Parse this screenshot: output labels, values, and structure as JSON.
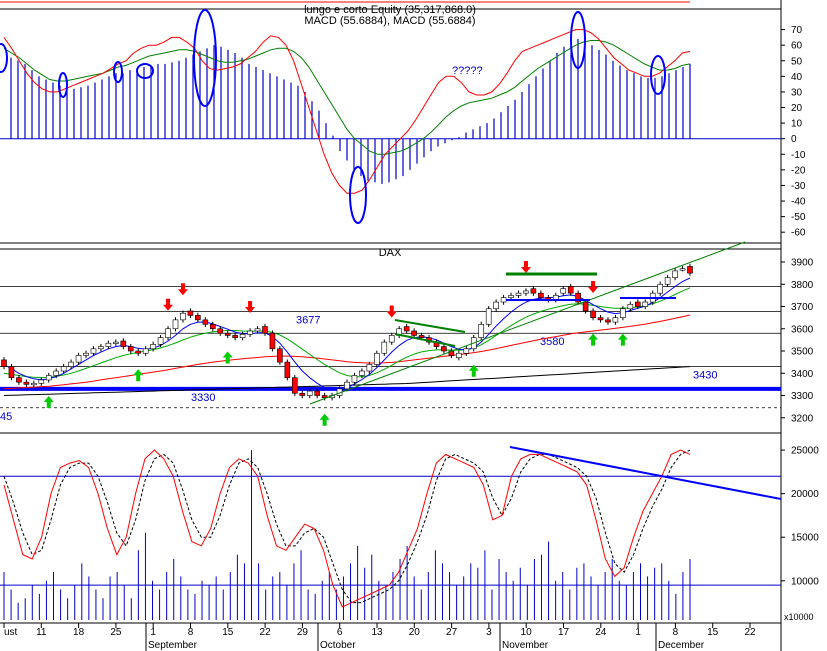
{
  "colors": {
    "background": "#ffffff",
    "frame": "#000000",
    "macd_hist": "#0000cc",
    "macd_line": "#ff0000",
    "signal_line": "#008000",
    "ellipse": "#0000ff",
    "annotation_text": "#0000cc",
    "bull_candle": "#ffffff",
    "bear_candle": "#ff0000",
    "arrow_down": "#ff0000",
    "arrow_up": "#00cc00",
    "support_line": "#0000ff",
    "ma_short": "#0000ff",
    "ma_mid": "#00aa00",
    "ma_long_red": "#ff0000",
    "ma_long_black": "#000000",
    "stoch_k": "#ff0000",
    "stoch_d": "#000000",
    "volume": "#0000cc",
    "green_line": "#008000"
  },
  "chart_data": [
    {
      "type": "line",
      "panel": "macd",
      "title_lines": [
        "lungo e corto Equity (35,317,868.0)",
        "MACD (55.6884), MACD (55.6884)"
      ],
      "annotation": "?????",
      "y_ticks": [
        70,
        60,
        50,
        40,
        30,
        20,
        10,
        0,
        -10,
        -20,
        -30,
        -40,
        -50,
        -60
      ],
      "y_tick_labels": [
        "70",
        "60",
        "50",
        "40",
        "30",
        "20",
        "10",
        "0",
        "-10",
        "-20",
        "-30",
        "-40",
        "-50",
        "-60"
      ],
      "ylim": [
        -65,
        80
      ],
      "histogram": [
        0,
        52,
        50,
        48,
        44,
        40,
        38,
        36,
        34,
        33,
        32,
        33,
        34,
        36,
        38,
        40,
        42,
        42,
        44,
        45,
        46,
        47,
        48,
        48,
        49,
        50,
        52,
        54,
        56,
        58,
        60,
        59,
        57,
        55,
        52,
        48,
        46,
        44,
        42,
        40,
        38,
        36,
        34,
        30,
        24,
        18,
        10,
        2,
        -8,
        -14,
        -20,
        -24,
        -27,
        -28,
        -29,
        -28,
        -26,
        -24,
        -20,
        -16,
        -12,
        -8,
        -5,
        -3,
        -1,
        1,
        4,
        6,
        8,
        10,
        13,
        17,
        21,
        25,
        30,
        35,
        40,
        45,
        50,
        55,
        59,
        62,
        64,
        63,
        60,
        57,
        54,
        50,
        47,
        44,
        42,
        40,
        39,
        39,
        40,
        42,
        44,
        46,
        48
      ],
      "macd": [
        65,
        58,
        50,
        42,
        36,
        32,
        30,
        30,
        32,
        34,
        36,
        38,
        40,
        42,
        45,
        48,
        50,
        55,
        58,
        60,
        60,
        62,
        65,
        65,
        62,
        58,
        50,
        45,
        44,
        45,
        46,
        48,
        52,
        56,
        62,
        66,
        65,
        60,
        50,
        35,
        20,
        5,
        -10,
        -22,
        -30,
        -35,
        -35,
        -33,
        -26,
        -18,
        -10,
        -5,
        0,
        5,
        12,
        20,
        28,
        36,
        40,
        40,
        36,
        30,
        28,
        28,
        30,
        35,
        42,
        50,
        56,
        58,
        60,
        62,
        64,
        66,
        68,
        70,
        70,
        68,
        64,
        58,
        52,
        48,
        44,
        42,
        40,
        40,
        42,
        46,
        50,
        55,
        56
      ],
      "signal": [
        58,
        55,
        52,
        48,
        44,
        41,
        38,
        37,
        37,
        38,
        39,
        40,
        41,
        42,
        44,
        46,
        47,
        49,
        51,
        53,
        54,
        55,
        56,
        57,
        57,
        56,
        54,
        52,
        50,
        49,
        49,
        50,
        51,
        53,
        55,
        57,
        58,
        58,
        56,
        52,
        46,
        38,
        30,
        22,
        14,
        6,
        0,
        -4,
        -8,
        -10,
        -10,
        -9,
        -8,
        -6,
        -3,
        0,
        4,
        9,
        14,
        18,
        21,
        23,
        24,
        25,
        26,
        28,
        30,
        33,
        37,
        41,
        45,
        48,
        51,
        54,
        57,
        60,
        62,
        63,
        63,
        62,
        60,
        57,
        54,
        51,
        48,
        46,
        44,
        44,
        45,
        47,
        48
      ]
    },
    {
      "type": "candlestick",
      "panel": "price",
      "title": "DAX",
      "y_ticks": [
        3900,
        3800,
        3700,
        3600,
        3500,
        3400,
        3300,
        3200
      ],
      "y_tick_labels": [
        "3900",
        "3800",
        "3700",
        "3600",
        "3500",
        "3400",
        "3300",
        "3200"
      ],
      "ylim": [
        3145,
        3945
      ],
      "level_labels": [
        {
          "value": 3677,
          "text": "3677"
        },
        {
          "value": 3330,
          "text": "3330"
        },
        {
          "value": 3580,
          "text": "3580"
        },
        {
          "value": 3430,
          "text": "3430"
        },
        {
          "value": 3245,
          "text": "45"
        }
      ],
      "horizontal_levels": [
        3790,
        3677,
        3580,
        3430,
        3245
      ],
      "support_level": 3330,
      "closes": [
        3430,
        3380,
        3360,
        3350,
        3355,
        3370,
        3390,
        3410,
        3430,
        3450,
        3480,
        3490,
        3510,
        3520,
        3535,
        3540,
        3520,
        3500,
        3490,
        3510,
        3530,
        3560,
        3600,
        3640,
        3670,
        3660,
        3640,
        3620,
        3600,
        3580,
        3570,
        3560,
        3575,
        3590,
        3600,
        3580,
        3510,
        3450,
        3380,
        3310,
        3300,
        3320,
        3300,
        3290,
        3300,
        3330,
        3360,
        3390,
        3410,
        3440,
        3490,
        3540,
        3570,
        3600,
        3590,
        3570,
        3560,
        3540,
        3520,
        3500,
        3480,
        3490,
        3510,
        3560,
        3620,
        3690,
        3720,
        3740,
        3750,
        3760,
        3770,
        3760,
        3740,
        3730,
        3750,
        3780,
        3760,
        3720,
        3680,
        3650,
        3640,
        3630,
        3650,
        3690,
        3710,
        3700,
        3720,
        3760,
        3800,
        3830,
        3860,
        3870,
        3850
      ],
      "opens": [
        3460,
        3430,
        3380,
        3360,
        3350,
        3355,
        3370,
        3390,
        3410,
        3430,
        3450,
        3480,
        3490,
        3510,
        3520,
        3535,
        3545,
        3520,
        3500,
        3490,
        3510,
        3530,
        3560,
        3600,
        3640,
        3680,
        3660,
        3640,
        3620,
        3600,
        3580,
        3570,
        3560,
        3575,
        3590,
        3610,
        3580,
        3510,
        3450,
        3380,
        3310,
        3300,
        3320,
        3300,
        3290,
        3300,
        3330,
        3360,
        3390,
        3410,
        3440,
        3490,
        3540,
        3570,
        3610,
        3590,
        3570,
        3560,
        3540,
        3520,
        3500,
        3470,
        3490,
        3510,
        3560,
        3620,
        3690,
        3720,
        3740,
        3750,
        3760,
        3780,
        3760,
        3740,
        3730,
        3760,
        3790,
        3760,
        3720,
        3680,
        3650,
        3640,
        3630,
        3650,
        3690,
        3720,
        3700,
        3720,
        3760,
        3800,
        3830,
        3870,
        3880
      ],
      "ma_short": [
        3440,
        3420,
        3400,
        3385,
        3375,
        3370,
        3375,
        3385,
        3400,
        3420,
        3440,
        3460,
        3480,
        3495,
        3510,
        3520,
        3525,
        3520,
        3512,
        3508,
        3512,
        3525,
        3545,
        3570,
        3600,
        3620,
        3630,
        3630,
        3622,
        3610,
        3598,
        3585,
        3578,
        3578,
        3582,
        3582,
        3565,
        3535,
        3495,
        3450,
        3410,
        3380,
        3355,
        3335,
        3325,
        3325,
        3335,
        3352,
        3372,
        3395,
        3425,
        3460,
        3495,
        3525,
        3548,
        3560,
        3565,
        3560,
        3550,
        3535,
        3520,
        3508,
        3505,
        3515,
        3540,
        3575,
        3612,
        3645,
        3675,
        3700,
        3720,
        3732,
        3738,
        3740,
        3742,
        3748,
        3752,
        3745,
        3728,
        3708,
        3690,
        3675,
        3668,
        3672,
        3682,
        3692,
        3702,
        3718,
        3740,
        3765,
        3790,
        3812,
        3828
      ],
      "ma_mid": [
        3400,
        3395,
        3390,
        3385,
        3382,
        3380,
        3382,
        3386,
        3392,
        3400,
        3410,
        3422,
        3434,
        3446,
        3458,
        3470,
        3480,
        3488,
        3494,
        3500,
        3506,
        3514,
        3524,
        3536,
        3550,
        3562,
        3572,
        3580,
        3586,
        3590,
        3592,
        3592,
        3590,
        3589,
        3590,
        3590,
        3584,
        3572,
        3555,
        3532,
        3508,
        3485,
        3462,
        3440,
        3420,
        3402,
        3390,
        3384,
        3384,
        3390,
        3402,
        3418,
        3436,
        3455,
        3472,
        3486,
        3496,
        3502,
        3505,
        3505,
        3504,
        3504,
        3506,
        3514,
        3528,
        3548,
        3570,
        3592,
        3614,
        3634,
        3652,
        3666,
        3678,
        3688,
        3696,
        3704,
        3710,
        3712,
        3710,
        3705,
        3700,
        3695,
        3692,
        3692,
        3694,
        3698,
        3703,
        3712,
        3724,
        3738,
        3754,
        3770,
        3784
      ],
      "ma_long_red": [
        3330,
        3332,
        3334,
        3336,
        3338,
        3340,
        3342,
        3345,
        3348,
        3352,
        3356,
        3360,
        3365,
        3370,
        3375,
        3380,
        3385,
        3390,
        3395,
        3400,
        3405,
        3410,
        3416,
        3422,
        3428,
        3434,
        3440,
        3445,
        3450,
        3454,
        3458,
        3462,
        3465,
        3468,
        3471,
        3474,
        3476,
        3477,
        3477,
        3476,
        3474,
        3471,
        3468,
        3464,
        3460,
        3456,
        3452,
        3449,
        3447,
        3446,
        3446,
        3447,
        3449,
        3452,
        3456,
        3460,
        3464,
        3468,
        3472,
        3476,
        3480,
        3484,
        3488,
        3493,
        3498,
        3504,
        3511,
        3518,
        3525,
        3532,
        3539,
        3546,
        3553,
        3559,
        3565,
        3571,
        3577,
        3582,
        3586,
        3590,
        3594,
        3598,
        3602,
        3606,
        3611,
        3616,
        3621,
        3627,
        3633,
        3640,
        3647,
        3654,
        3662
      ],
      "ma_long_black": [
        3300,
        3301,
        3302,
        3303,
        3304,
        3305,
        3306,
        3307,
        3308,
        3309,
        3310,
        3311,
        3312,
        3313,
        3314,
        3315,
        3316,
        3317,
        3318,
        3319,
        3320,
        3321,
        3322,
        3323,
        3324,
        3325,
        3326,
        3327,
        3328,
        3329,
        3330,
        3331,
        3332,
        3333,
        3334,
        3335,
        3336,
        3337,
        3338,
        3339,
        3340,
        3341,
        3342,
        3343,
        3344,
        3345,
        3346,
        3347,
        3348,
        3349,
        3350,
        3351,
        3352,
        3353,
        3354,
        3356,
        3358,
        3360,
        3362,
        3364,
        3366,
        3368,
        3370,
        3372,
        3374,
        3376,
        3378,
        3380,
        3382,
        3384,
        3386,
        3388,
        3390,
        3392,
        3394,
        3396,
        3398,
        3400,
        3402,
        3404,
        3406,
        3408,
        3410,
        3412,
        3414,
        3416,
        3418,
        3420,
        3422,
        3424,
        3426,
        3428,
        3430
      ],
      "arrows_down": [
        22,
        24,
        33,
        52,
        70,
        79,
        93
      ],
      "arrows_up": [
        6,
        18,
        30,
        43,
        63,
        79,
        83
      ]
    },
    {
      "type": "line",
      "panel": "stochastic_volume",
      "y_ticks": [
        25000,
        20000,
        15000,
        10000
      ],
      "y_tick_labels": [
        "25000",
        "20000",
        "15000",
        "10000"
      ],
      "ylim": [
        5500,
        26500
      ],
      "unit_label": "x10000",
      "reference_levels": [
        22000,
        9500
      ],
      "stoch_k": [
        21000,
        17000,
        13000,
        12500,
        15000,
        20000,
        23000,
        23500,
        23800,
        23000,
        20000,
        16000,
        13000,
        15000,
        20000,
        24000,
        25000,
        24000,
        22000,
        18000,
        14500,
        14000,
        16000,
        20000,
        23000,
        24000,
        23500,
        22000,
        17500,
        14000,
        13500,
        15000,
        16500,
        16000,
        13500,
        9500,
        7000,
        7500,
        8000,
        8500,
        9000,
        9500,
        11000,
        13500,
        16000,
        20000,
        23500,
        24500,
        24000,
        23500,
        23000,
        21000,
        17000,
        17500,
        22000,
        24000,
        24500,
        24500,
        24000,
        23500,
        23000,
        22500,
        21000,
        17000,
        12500,
        10500,
        11500,
        15000,
        18000,
        20000,
        22000,
        24500,
        25000,
        24500
      ],
      "stoch_d": [
        22000,
        19000,
        15500,
        13000,
        13500,
        17000,
        21000,
        23000,
        23500,
        23500,
        22000,
        19000,
        15500,
        14000,
        17000,
        21500,
        24000,
        24500,
        23500,
        20500,
        17000,
        15000,
        15000,
        17500,
        21000,
        23500,
        24000,
        23000,
        20000,
        16500,
        14000,
        14000,
        15500,
        16000,
        15000,
        12000,
        9000,
        7500,
        7500,
        8000,
        8500,
        9000,
        10000,
        12000,
        14500,
        17500,
        21500,
        24000,
        24500,
        24000,
        23500,
        22500,
        19500,
        17500,
        19500,
        22500,
        24000,
        24500,
        24500,
        24000,
        23500,
        23000,
        22000,
        19500,
        15500,
        12000,
        11000,
        13000,
        16000,
        18500,
        20500,
        23000,
        24500,
        25000
      ],
      "volume": [
        11000,
        9000,
        7500,
        8000,
        9500,
        8500,
        10000,
        11000,
        9000,
        8000,
        9500,
        12000,
        10500,
        9000,
        8000,
        10500,
        11000,
        9500,
        8000,
        13500,
        15500,
        10000,
        9000,
        11000,
        12500,
        10500,
        9000,
        8500,
        10000,
        9500,
        10500,
        9000,
        11000,
        13000,
        12000,
        25000,
        12000,
        9000,
        10500,
        11000,
        9500,
        12000,
        13500,
        9000,
        8500,
        10000,
        11000,
        9000,
        10500,
        12000,
        14000,
        11500,
        13000,
        10000,
        9500,
        11000,
        12500,
        14000,
        10500,
        9000,
        11000,
        13500,
        12000,
        11000,
        9500,
        10500,
        12000,
        11500,
        13500,
        9000,
        12500,
        11000,
        10000,
        11500,
        9500,
        12500,
        13000,
        14500,
        10000,
        11000,
        9000,
        11500,
        12000,
        10500,
        9500,
        11000,
        12500,
        10000,
        9500,
        11000,
        12000,
        10500,
        11500,
        12000,
        10000,
        8500,
        11000,
        12500
      ]
    }
  ],
  "x_axis": {
    "labels": [
      "ust",
      "11",
      "18",
      "25",
      "1",
      "8",
      "15",
      "22",
      "29",
      "6",
      "13",
      "20",
      "27",
      "3",
      "10",
      "17",
      "24",
      "1",
      "8",
      "15",
      "22"
    ],
    "months": [
      "September",
      "October",
      "November",
      "December"
    ]
  }
}
